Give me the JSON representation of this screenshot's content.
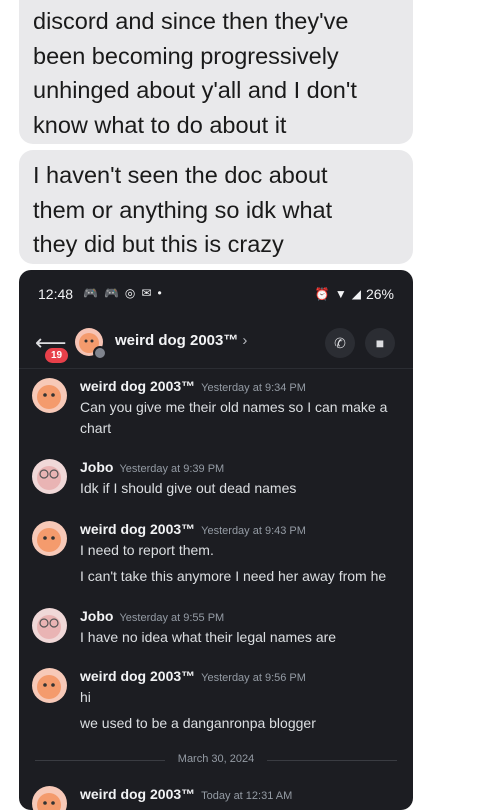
{
  "bubbles": [
    {
      "lines": [
        "discord and since then they've",
        "been becoming progressively",
        "unhinged about y'all and I don't",
        "know what to do  about it"
      ]
    },
    {
      "lines": [
        "I haven't seen the doc about",
        "them or anything so idk what",
        "they did but this is crazy"
      ]
    }
  ],
  "screenshot": {
    "status": {
      "time": "12:48",
      "battery": "26%"
    },
    "header": {
      "back_badge": "19",
      "name": "weird dog 2003™",
      "chevron": "›"
    },
    "messages": [
      {
        "author": "weird dog 2003™",
        "time": "Yesterday at 9:34 PM",
        "lines": [
          "Can you give me their old names so I can make a",
          "chart"
        ]
      },
      {
        "author": "Jobo",
        "time": "Yesterday at 9:39 PM",
        "lines": [
          "Idk if I should give out dead names"
        ]
      },
      {
        "author": "weird dog 2003™",
        "time": "Yesterday at 9:43 PM",
        "lines": [
          "I need to report them.",
          "I can't take this anymore I need her away from he"
        ]
      },
      {
        "author": "Jobo",
        "time": "Yesterday at 9:55 PM",
        "lines": [
          "I have no idea what their legal names are"
        ]
      },
      {
        "author": "weird dog 2003™",
        "time": "Yesterday at 9:56 PM",
        "lines": [
          "hi",
          "we used to be a danganronpa blogger"
        ]
      },
      {
        "author": "weird dog 2003™",
        "time": "Today at 12:31 AM",
        "lines": []
      }
    ],
    "date_divider": "March 30, 2024"
  },
  "colors": {
    "bubble": "#e9e9eb",
    "discord_bg": "#1c1d22",
    "badge": "#e8404a"
  }
}
